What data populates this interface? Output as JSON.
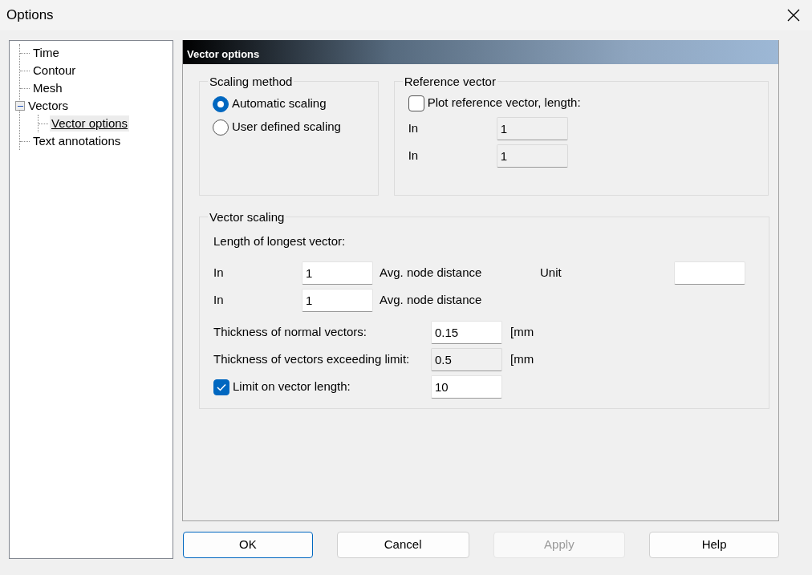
{
  "window": {
    "title": "Options"
  },
  "tree": [
    {
      "label": "Time",
      "selected": false
    },
    {
      "label": "Contour",
      "selected": false
    },
    {
      "label": "Mesh",
      "selected": false
    },
    {
      "label": "Vectors",
      "selected": false,
      "expanded": true,
      "children": [
        {
          "label": "Vector options",
          "selected": true
        }
      ]
    },
    {
      "label": "Text annotations",
      "selected": false
    }
  ],
  "panel": {
    "title": "Vector options"
  },
  "scaling_method": {
    "title": "Scaling method",
    "options": [
      {
        "label": "Automatic scaling",
        "selected": true
      },
      {
        "label": "User defined scaling",
        "selected": false
      }
    ]
  },
  "reference_vector": {
    "title": "Reference vector",
    "checkbox": {
      "label": "Plot reference vector, length:",
      "checked": false
    },
    "rows": [
      {
        "label": "In",
        "value": "1",
        "disabled": true
      },
      {
        "label": "In",
        "value": "1",
        "disabled": true
      }
    ]
  },
  "vector_scaling": {
    "title": "Vector scaling",
    "heading": "Length of longest vector:",
    "length_rows": [
      {
        "label": "In",
        "value": "1",
        "unit": "Avg. node distance",
        "extra_label": "Unit"
      },
      {
        "label": "In",
        "value": "1",
        "unit": "Avg. node distance"
      }
    ],
    "thickness_rows": [
      {
        "kind": "text",
        "label": "Thickness of normal vectors:",
        "value": "0.15",
        "unit": "[mm",
        "disabled": false
      },
      {
        "kind": "text",
        "label": "Thickness of vectors exceeding limit:",
        "value": "0.5",
        "unit": "[mm",
        "disabled": true
      },
      {
        "kind": "checkbox",
        "label": "Limit on vector length:",
        "checked": true,
        "value": "10",
        "disabled": false
      }
    ]
  },
  "buttons": [
    {
      "label": "OK",
      "default": true,
      "disabled": false
    },
    {
      "label": "Cancel",
      "default": false,
      "disabled": false
    },
    {
      "label": "Apply",
      "default": false,
      "disabled": true
    },
    {
      "label": "Help",
      "default": false,
      "disabled": false
    }
  ]
}
